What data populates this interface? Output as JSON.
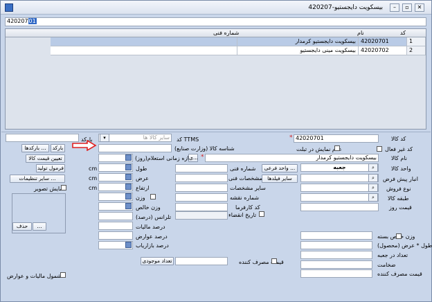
{
  "window": {
    "title": "بیسکویت دایجستیو-420207"
  },
  "search": {
    "code_prefix": "420207",
    "code_suffix": "01"
  },
  "grid": {
    "headers": {
      "code": "کد",
      "name": "نام",
      "tech_no": "شماره فنی"
    },
    "rows": [
      {
        "num": "1",
        "code": "42020701",
        "name": "بیسکویت دایجستیو کرمدار",
        "tech": ""
      },
      {
        "num": "2",
        "code": "42020702",
        "name": "بیسکویت مینی دایجستیو",
        "tech": ""
      }
    ]
  },
  "form": {
    "code_label": "کد کالا",
    "code_value": "42020701",
    "inactive_label": "کد غیر فعال",
    "show_tablet_label": "عدم نمایش در تبلت",
    "name_label": "نام کالا",
    "name_value": "بیسکویت دایجستیو کرمدار",
    "unit_label": "واحد کالا",
    "unit_value": "جعبه",
    "sub_unit_btn": "واحد فرعی ...",
    "other_fields_btn": "سایر فیلدها",
    "default_wh_label": "انبار پیش فرض",
    "sale_type_label": "نوع فروش",
    "category_label": "طبقه کالا",
    "daily_price_label": "قیمت روز",
    "tech_label": "شماره فنی",
    "specs_label": "مشخصات فنی",
    "other_specs_label": "سایر مشخصات",
    "map_no_label": "شماره نقشه",
    "factory_code_label": "کد کارفرما",
    "expiry_label": "تاریخ انقضاء",
    "ttms_label": "کد TTMS",
    "other_goods_placeholder": "سایر کالا ها",
    "barcode_label": "بارکد",
    "barcode_btn": "بارکد",
    "barcodes_btn": "بارکدها ...",
    "set_price_btn": "تعیین قیمت کالا",
    "production_formula_btn": "فرمول تولید",
    "other_settings_btn": "سایر تنظیمات ...",
    "show_image_label": "نمایش تصویر",
    "id_label": "شناسه کالا (وزارت صنایع)",
    "time_period_label": "بازه زمانی استعلام(روز)",
    "dot_btn": "ی...",
    "length_label": "طول",
    "width_label": "عرض",
    "height_label": "ارتفاع",
    "weight_label": "وزن",
    "net_weight_label": "وزن خالص",
    "tolerance_label": "تلرانس (درصد)",
    "tax_label": "درصد مالیات",
    "duties_label": "درصد عوارض",
    "marketer_label": "درصد بازاریاب",
    "unit_cm": "cm",
    "unit_cm2": "cm",
    "unit_cm3": "cm",
    "delete_btn": "حذف",
    "more_btn": "...",
    "consumer_price_label": "قیمت مصرف کننده",
    "existing_count_btn": "تعداد موجودی",
    "tax_subject_label": "مشمول مالیات و عوارض",
    "net_pack_weight_label": "وزن خالص بسته",
    "dims_label": "طول * عرض (محصول)",
    "per_box_label": "تعداد در جعبه",
    "thickness_label": "ضخامت",
    "consumer_price_label2": "قیمت مصرف کننده"
  }
}
